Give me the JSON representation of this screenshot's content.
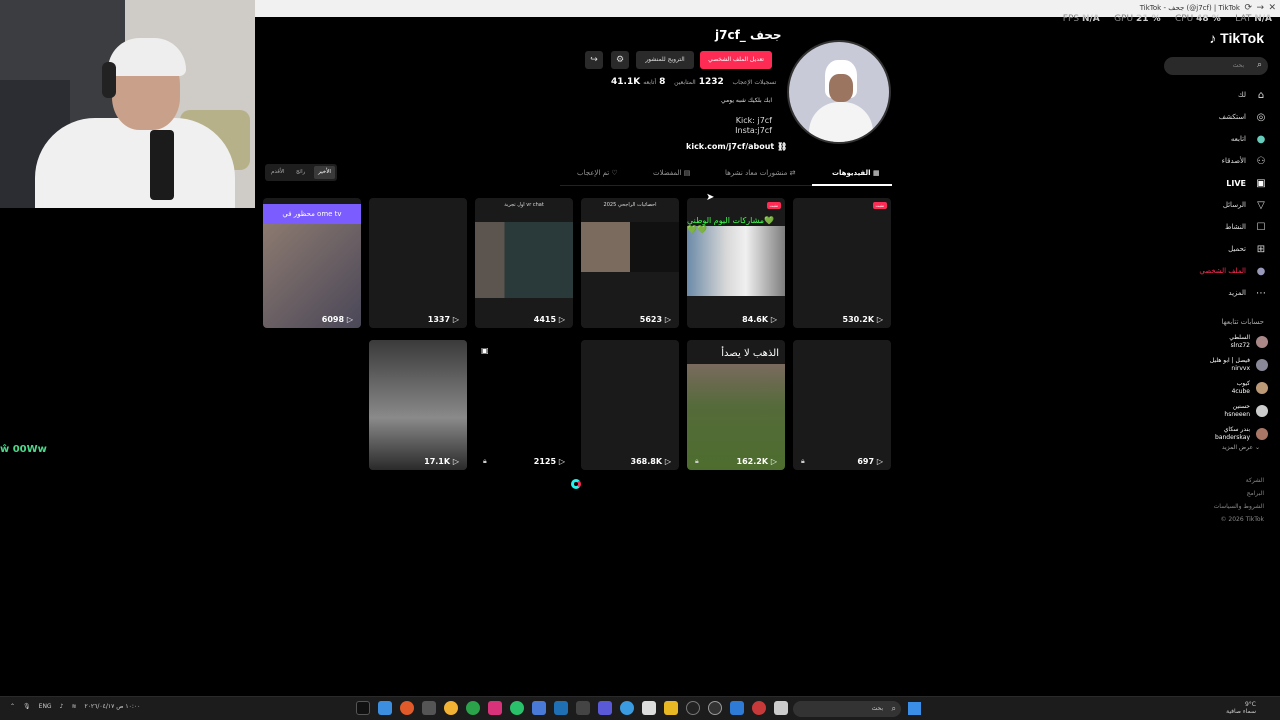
{
  "titlebar": {
    "title": "TikTok - جحف (@j7cf) | TikTok"
  },
  "stats": {
    "fps_label": "FPS",
    "fps": "N/A",
    "gpu_label": "GPU",
    "gpu": "21 %",
    "cpu_label": "CPU",
    "cpu": "48 %",
    "lat_label": "LAT",
    "lat": "N/A"
  },
  "chat": {
    "line": "ŵ 00Ww"
  },
  "sidebar": {
    "logo": "TikTok",
    "search_placeholder": "بحث",
    "items": [
      {
        "label": "لك",
        "icon": "home-icon"
      },
      {
        "label": "استكشف",
        "icon": "compass-icon"
      },
      {
        "label": "اتابعه",
        "icon": "avatar-icon"
      },
      {
        "label": "الأصدقاء",
        "icon": "friends-icon"
      },
      {
        "label": "LIVE",
        "icon": "live-icon"
      },
      {
        "label": "الرسائل",
        "icon": "send-icon"
      },
      {
        "label": "النشاط",
        "icon": "inbox-icon"
      },
      {
        "label": "تحميل",
        "icon": "upload-icon"
      },
      {
        "label": "الملف الشخصي",
        "icon": "profile-icon"
      },
      {
        "label": "المزيد",
        "icon": "more-icon"
      }
    ],
    "following_header": "حسابات تتابعها",
    "following": [
      {
        "name": "السلطي",
        "handle": "slnz72"
      },
      {
        "name": "فيصل | ابو هليل",
        "handle": "nirvvx"
      },
      {
        "name": "كيوب",
        "handle": "4cube"
      },
      {
        "name": "حسنين",
        "handle": "hsneeen"
      },
      {
        "name": "بندر سكاي",
        "handle": "banderskay"
      }
    ],
    "see_more": "عرض المزيد",
    "links": [
      "الشركة",
      "البرامج",
      "الشروط والسياسات",
      "© 2026 TikTok"
    ]
  },
  "profile": {
    "name": "j7cf_ جحف",
    "edit_button": "تعديل الملف الشخصي",
    "promote_button": "الترويج للمنشور",
    "following_count": "8",
    "following_label": "أتابعه",
    "followers_count": "1232",
    "followers_label": "المتابعين",
    "likes_count": "41.1K",
    "likes_label": "تسجيلات الإعجاب",
    "bio_line1": "ابك بلكيك شبه يومي",
    "bio_line2": "Kick: j7cf",
    "bio_line3": "Insta:j7cf",
    "link": "kick.com/j7cf/about"
  },
  "tabs": {
    "videos": "الفيديوهات",
    "reposts": "منشورات معاد نشرها",
    "favorites": "المفضلات",
    "liked": "تم الإعجاب"
  },
  "sort": {
    "latest": "الأخير",
    "popular": "رائج",
    "oldest": "الأقدم"
  },
  "videos": [
    {
      "views": "530.2K",
      "pinned": "مثبت",
      "caption": ""
    },
    {
      "views": "84.6K",
      "pinned": "مثبت",
      "caption": "مشاركات اليوم الوطني💚💚💚"
    },
    {
      "views": "5623",
      "pinned": "",
      "caption": "احصائيات الراجحي 2025"
    },
    {
      "views": "4415",
      "pinned": "",
      "caption": "اول تجربة vr chat"
    },
    {
      "views": "1337",
      "pinned": "",
      "caption": ""
    },
    {
      "views": "6098",
      "pinned": "",
      "caption": "محظور في ome tv"
    },
    {
      "views": "697",
      "pinned": "",
      "caption": ""
    },
    {
      "views": "162.2K",
      "pinned": "",
      "caption": "الذهب لا يصدأ"
    },
    {
      "views": "368.8K",
      "pinned": "",
      "caption": ""
    },
    {
      "views": "2125",
      "pinned": "",
      "caption": ""
    },
    {
      "views": "17.1K",
      "pinned": "",
      "caption": ""
    }
  ],
  "taskbar": {
    "lang": "ENG",
    "search": "بحث",
    "weather": "9°C",
    "weather_sub": "سماء صافية",
    "time": "١٠:٠٠ ص",
    "date": "٢٠٢٦/٠٤/١٧"
  }
}
